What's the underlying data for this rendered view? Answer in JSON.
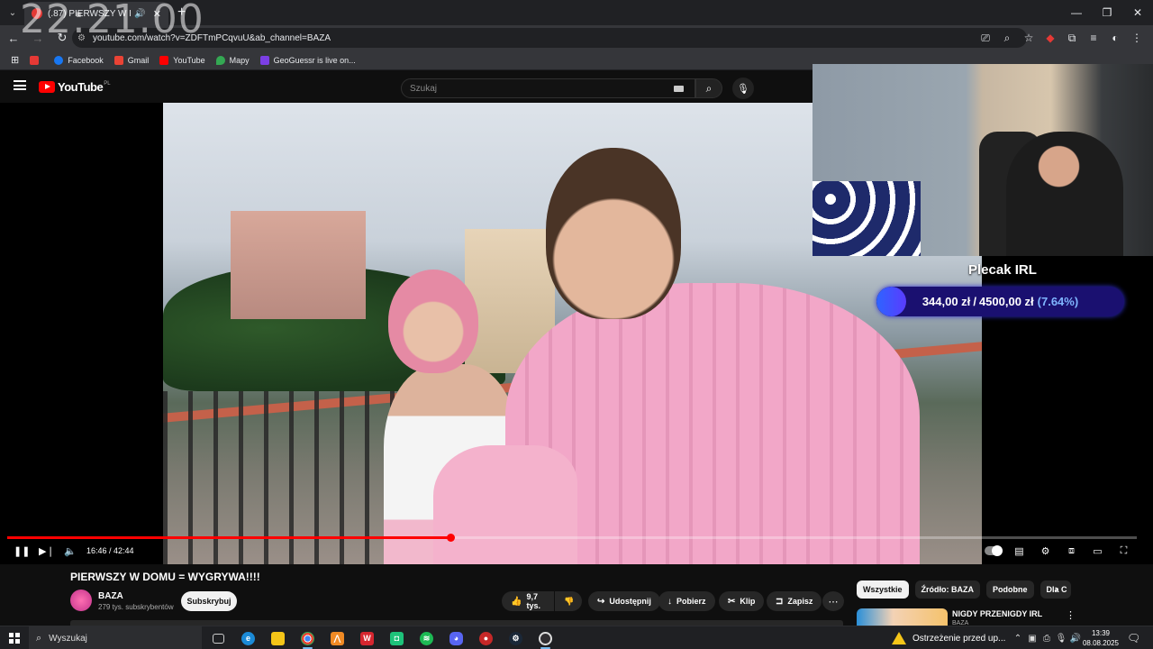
{
  "clock_overlay": "22:21.00",
  "browser": {
    "tab_title": "(.87) PIERWSZY W DOM",
    "url": "youtube.com/watch?v=ZDFTmPCqvuU&ab_channel=BAZA",
    "bookmarks": [
      {
        "label": "",
        "color": "#e53935"
      },
      {
        "label": "Facebook",
        "color": "#1877f2"
      },
      {
        "label": "Gmail",
        "color": "#ea4335"
      },
      {
        "label": "YouTube",
        "color": "#ff0000"
      },
      {
        "label": "Mapy",
        "color": "#34a853"
      },
      {
        "label": "GeoGuessr is live on...",
        "color": "#7b3fe4"
      }
    ]
  },
  "youtube": {
    "logo_text": "YouTube",
    "logo_region": "PL",
    "search_placeholder": "Szukaj"
  },
  "stream_overlay": {
    "goal_title": "Plecak IRL",
    "goal_current": "344,00 zł",
    "goal_separator": "/",
    "goal_target": "4500,00 zł",
    "goal_percent": "(7.64%)",
    "goal_fraction": 0.0764
  },
  "player": {
    "time": "16:46 / 42:44",
    "progress_fraction": 0.3924
  },
  "video": {
    "title": "PIERWSZY W DOMU = WYGRYWA!!!!",
    "channel": "BAZA",
    "subscribers": "279 tys. subskrybentów",
    "subscribe_label": "Subskrybuj",
    "likes": "9,7 tys.",
    "share_label": "Udostępnij",
    "download_label": "Pobierz",
    "clip_label": "Klip",
    "save_label": "Zapisz"
  },
  "sidebar": {
    "chips": [
      "Wszystkie",
      "Źródło: BAZA",
      "Podobne",
      "Dla C"
    ],
    "rec_title": "NIGDY PRZENIGDY IRL",
    "rec_channel": "BAZA"
  },
  "taskbar": {
    "search_label": "Wyszukaj",
    "warning_text": "Ostrzeżenie przed up...",
    "time": "13:39",
    "date": "08.08.2025"
  }
}
